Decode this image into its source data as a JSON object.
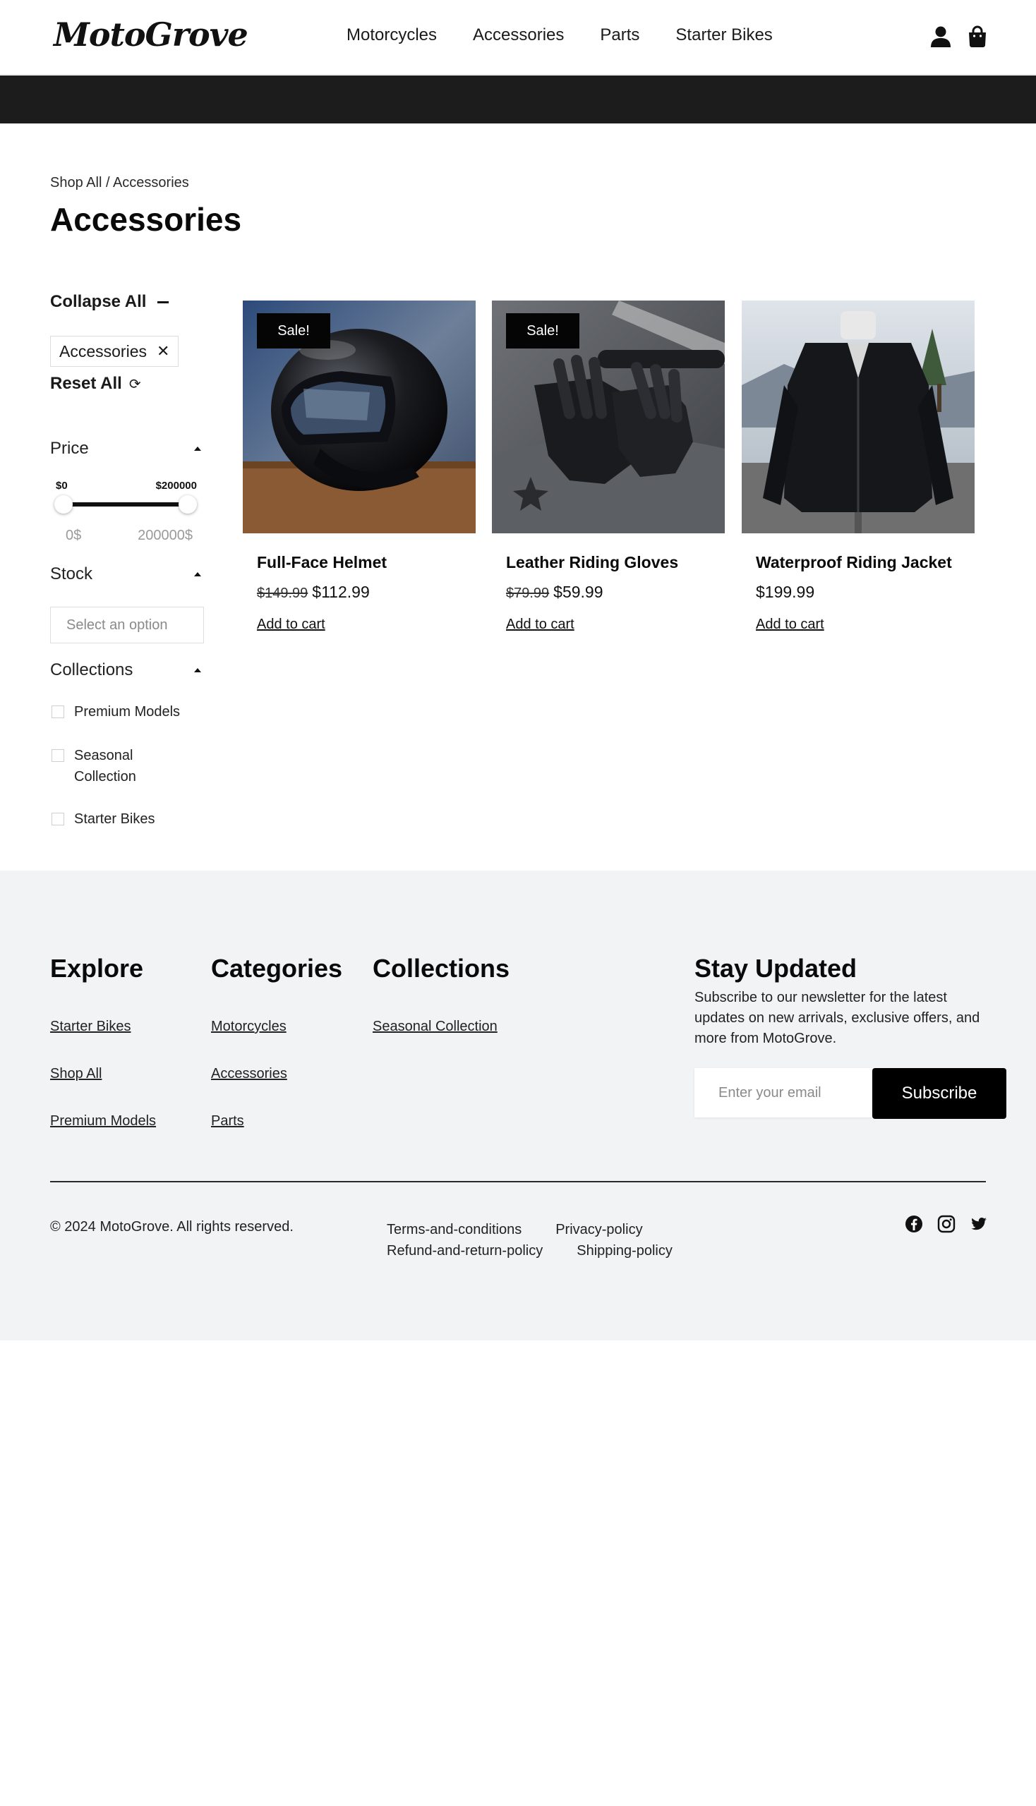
{
  "brand": {
    "logo": "MotoGrove"
  },
  "nav": [
    "Motorcycles",
    "Accessories",
    "Parts",
    "Starter Bikes"
  ],
  "header_icons": {
    "account": "user-icon",
    "cart": "shopping-bag-icon"
  },
  "breadcrumb": "Shop All / Accessories",
  "page_title": "Accessories",
  "filters": {
    "collapse_all": "Collapse All",
    "active_chip": "Accessories",
    "chip_remove": "✕",
    "reset_all": "Reset All",
    "reset_icon": "⟳",
    "price": {
      "label": "Price",
      "min_label": "$0",
      "max_label": "$200000",
      "min_readout": "0$",
      "max_readout": "200000$"
    },
    "stock": {
      "label": "Stock",
      "placeholder": "Select an option"
    },
    "collections": {
      "label": "Collections",
      "options": [
        "Premium Models",
        "Seasonal Collection",
        "Starter Bikes"
      ]
    }
  },
  "products": [
    {
      "name": "Full-Face Helmet",
      "badge": "Sale!",
      "old_price": "$149.99",
      "price": "$112.99",
      "cta": "Add to cart"
    },
    {
      "name": "Leather Riding Gloves",
      "badge": "Sale!",
      "old_price": "$79.99",
      "price": "$59.99",
      "cta": "Add to cart"
    },
    {
      "name": "Waterproof Riding Jacket",
      "badge": "",
      "old_price": "",
      "price": "$199.99",
      "cta": "Add to cart"
    }
  ],
  "footer": {
    "explore": {
      "title": "Explore",
      "links": [
        "Starter Bikes",
        "Shop All",
        "Premium Models"
      ]
    },
    "categories": {
      "title": "Categories",
      "links": [
        "Motorcycles",
        "Accessories",
        "Parts"
      ]
    },
    "collections": {
      "title": "Collections",
      "links": [
        "Seasonal Collection"
      ]
    },
    "newsletter": {
      "title": "Stay Updated",
      "text": "Subscribe to our newsletter for the latest updates on new arrivals, exclusive offers, and more from MotoGrove.",
      "placeholder": "Enter your email",
      "button": "Subscribe"
    },
    "copyright": "© 2024 MotoGrove. All rights reserved.",
    "legal": [
      "Terms-and-conditions",
      "Privacy-policy",
      "Refund-and-return-policy",
      "Shipping-policy"
    ],
    "socials": [
      "facebook-icon",
      "instagram-icon",
      "twitter-icon"
    ]
  }
}
